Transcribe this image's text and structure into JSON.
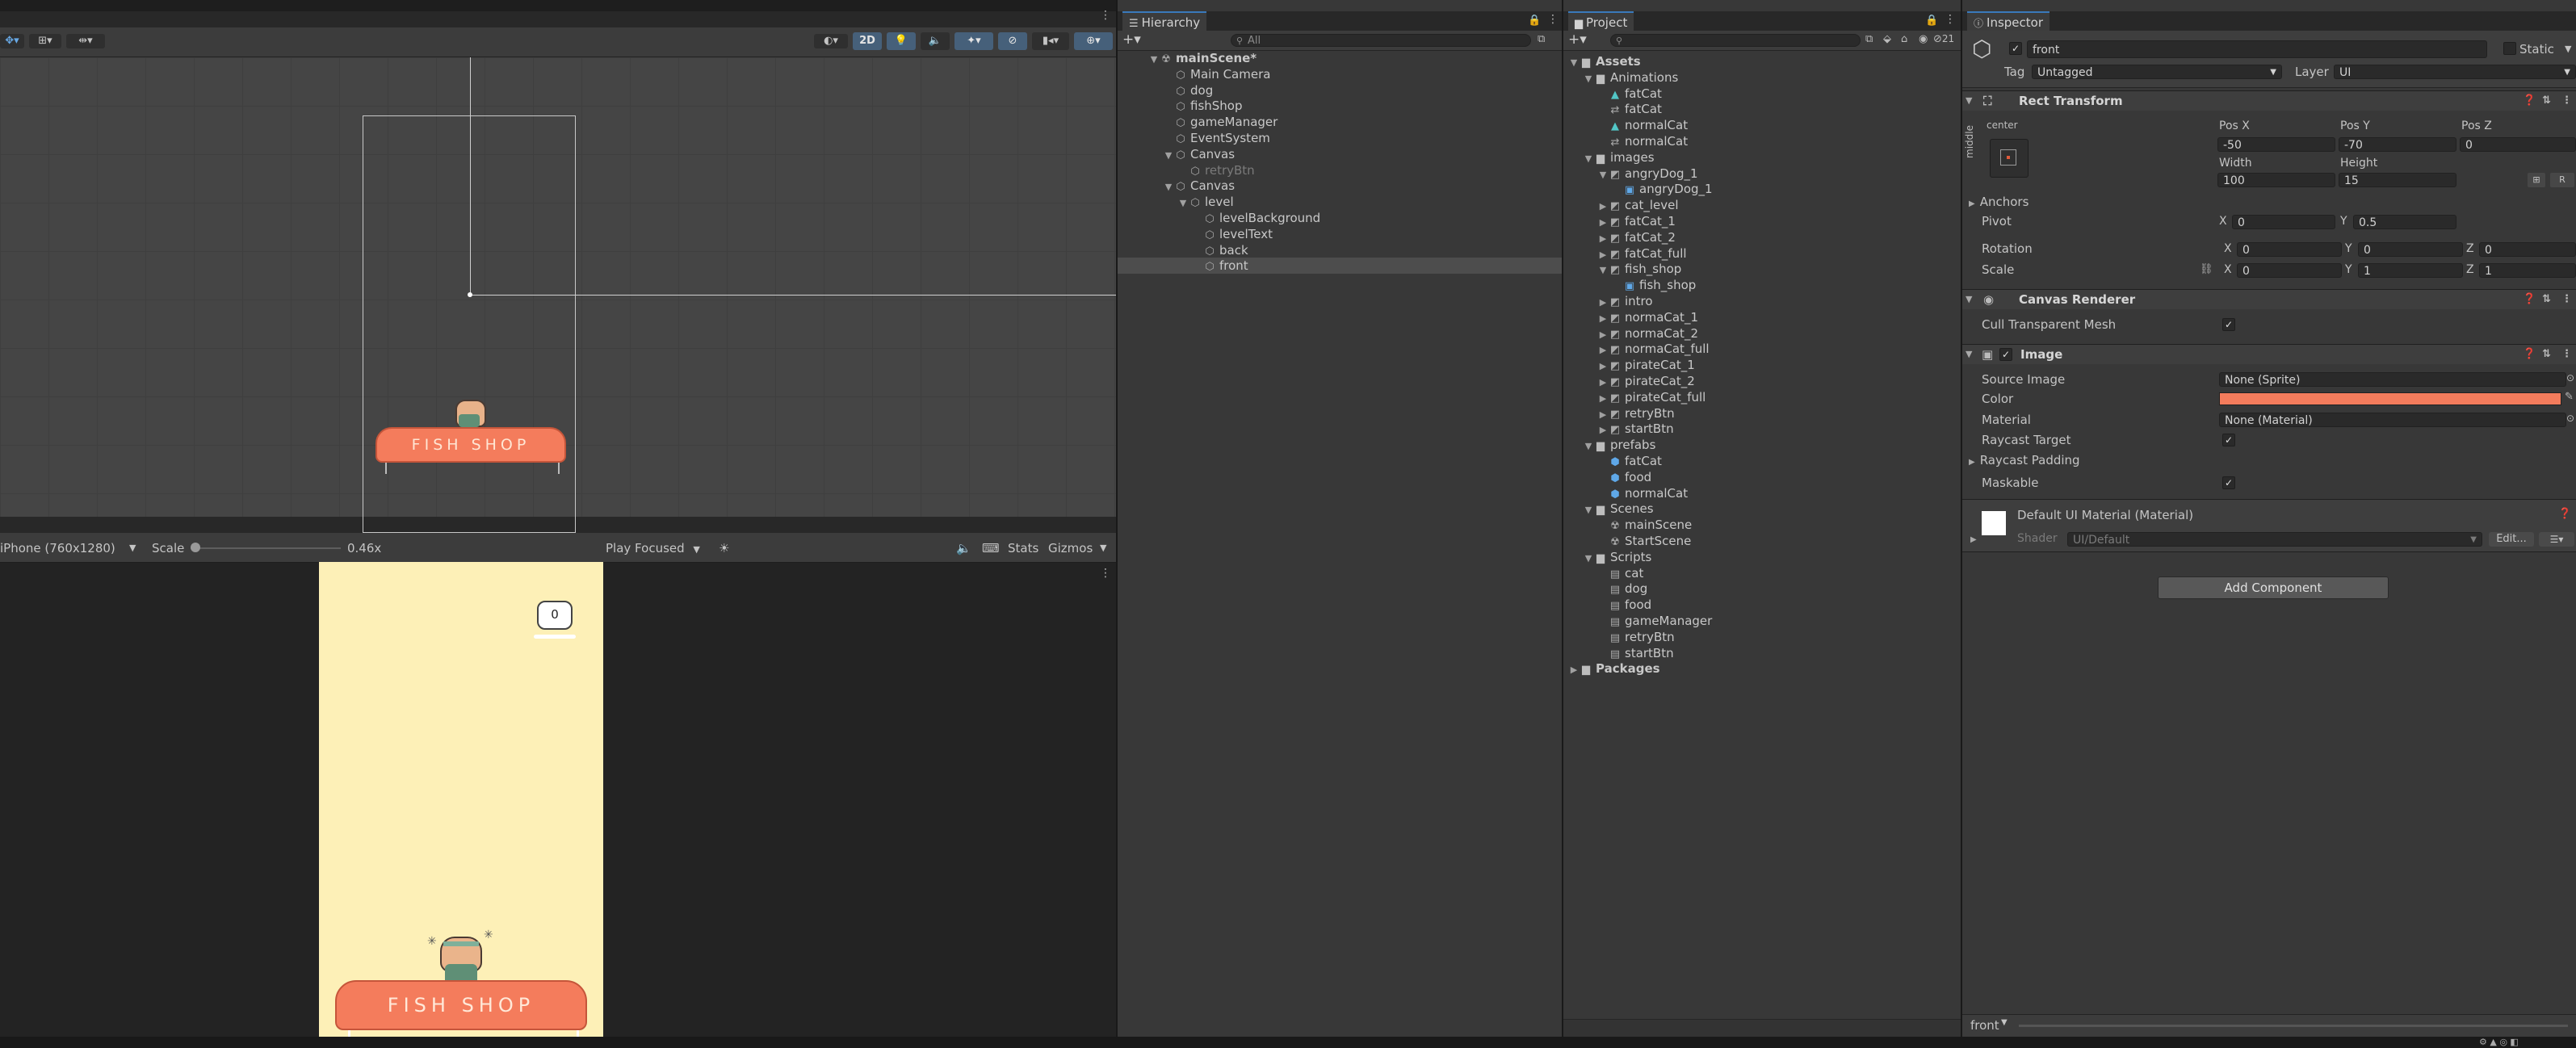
{
  "scene": {
    "tools_left": [
      "move-gizmo",
      "rect-tool",
      "snap-tool"
    ],
    "btn_2d": "2D",
    "gizmo_dropdowns": [
      "lighting",
      "audio",
      "effects",
      "hidden",
      "camera",
      "gizmos"
    ]
  },
  "game": {
    "resolution": "iPhone (760x1280)",
    "scale_label": "Scale",
    "scale_value": "0.46x",
    "play_mode": "Play Focused",
    "stats": "Stats",
    "gizmos": "Gizmos",
    "score": "0",
    "shop_sign": "FISH  SHOP",
    "colors": {
      "background": "#fdf0b7",
      "awning": "#f47c5c"
    }
  },
  "hierarchy": {
    "tab": "Hierarchy",
    "search_placeholder": "All",
    "items": [
      {
        "label": "mainScene*",
        "depth": 0,
        "icon": "unity-scene-icon",
        "expanded": true,
        "bold": true
      },
      {
        "label": "Main Camera",
        "depth": 1,
        "icon": "gameobject-icon"
      },
      {
        "label": "dog",
        "depth": 1,
        "icon": "gameobject-icon"
      },
      {
        "label": "fishShop",
        "depth": 1,
        "icon": "gameobject-icon"
      },
      {
        "label": "gameManager",
        "depth": 1,
        "icon": "gameobject-icon"
      },
      {
        "label": "EventSystem",
        "depth": 1,
        "icon": "gameobject-icon"
      },
      {
        "label": "Canvas",
        "depth": 1,
        "icon": "gameobject-icon",
        "expanded": true
      },
      {
        "label": "retryBtn",
        "depth": 2,
        "icon": "gameobject-icon",
        "disabled": true
      },
      {
        "label": "Canvas",
        "depth": 1,
        "icon": "gameobject-icon",
        "expanded": true
      },
      {
        "label": "level",
        "depth": 2,
        "icon": "gameobject-icon",
        "expanded": true
      },
      {
        "label": "levelBackground",
        "depth": 3,
        "icon": "gameobject-icon"
      },
      {
        "label": "levelText",
        "depth": 3,
        "icon": "gameobject-icon"
      },
      {
        "label": "back",
        "depth": 3,
        "icon": "gameobject-icon"
      },
      {
        "label": "front",
        "depth": 3,
        "icon": "gameobject-icon",
        "selected": true
      }
    ]
  },
  "project": {
    "tab": "Project",
    "badge": "21",
    "items": [
      {
        "label": "Assets",
        "depth": 0,
        "icon": "folder-icon",
        "expanded": true,
        "bold": true
      },
      {
        "label": "Animations",
        "depth": 1,
        "icon": "folder-icon",
        "expanded": true
      },
      {
        "label": "fatCat",
        "depth": 2,
        "icon": "animation-clip-icon"
      },
      {
        "label": "fatCat",
        "depth": 2,
        "icon": "animator-controller-icon"
      },
      {
        "label": "normalCat",
        "depth": 2,
        "icon": "animation-clip-icon"
      },
      {
        "label": "normalCat",
        "depth": 2,
        "icon": "animator-controller-icon"
      },
      {
        "label": "images",
        "depth": 1,
        "icon": "folder-icon",
        "expanded": true
      },
      {
        "label": "angryDog_1",
        "depth": 2,
        "icon": "texture-icon",
        "expanded": true
      },
      {
        "label": "angryDog_1",
        "depth": 3,
        "icon": "sprite-icon"
      },
      {
        "label": "cat_level",
        "depth": 2,
        "icon": "texture-icon",
        "collapsed": true
      },
      {
        "label": "fatCat_1",
        "depth": 2,
        "icon": "texture-icon",
        "collapsed": true
      },
      {
        "label": "fatCat_2",
        "depth": 2,
        "icon": "texture-icon",
        "collapsed": true
      },
      {
        "label": "fatCat_full",
        "depth": 2,
        "icon": "texture-icon",
        "collapsed": true
      },
      {
        "label": "fish_shop",
        "depth": 2,
        "icon": "texture-icon",
        "expanded": true
      },
      {
        "label": "fish_shop",
        "depth": 3,
        "icon": "sprite-icon"
      },
      {
        "label": "intro",
        "depth": 2,
        "icon": "texture-icon",
        "collapsed": true
      },
      {
        "label": "normaCat_1",
        "depth": 2,
        "icon": "texture-icon",
        "collapsed": true
      },
      {
        "label": "normaCat_2",
        "depth": 2,
        "icon": "texture-icon",
        "collapsed": true
      },
      {
        "label": "normaCat_full",
        "depth": 2,
        "icon": "texture-icon",
        "collapsed": true
      },
      {
        "label": "pirateCat_1",
        "depth": 2,
        "icon": "texture-icon",
        "collapsed": true
      },
      {
        "label": "pirateCat_2",
        "depth": 2,
        "icon": "texture-icon",
        "collapsed": true
      },
      {
        "label": "pirateCat_full",
        "depth": 2,
        "icon": "texture-icon",
        "collapsed": true
      },
      {
        "label": "retryBtn",
        "depth": 2,
        "icon": "texture-icon",
        "collapsed": true
      },
      {
        "label": "startBtn",
        "depth": 2,
        "icon": "texture-icon",
        "collapsed": true
      },
      {
        "label": "prefabs",
        "depth": 1,
        "icon": "folder-icon",
        "expanded": true
      },
      {
        "label": "fatCat",
        "depth": 2,
        "icon": "prefab-icon"
      },
      {
        "label": "food",
        "depth": 2,
        "icon": "prefab-icon"
      },
      {
        "label": "normalCat",
        "depth": 2,
        "icon": "prefab-icon"
      },
      {
        "label": "Scenes",
        "depth": 1,
        "icon": "folder-icon",
        "expanded": true
      },
      {
        "label": "mainScene",
        "depth": 2,
        "icon": "unity-scene-icon"
      },
      {
        "label": "StartScene",
        "depth": 2,
        "icon": "unity-scene-icon"
      },
      {
        "label": "Scripts",
        "depth": 1,
        "icon": "folder-icon",
        "expanded": true
      },
      {
        "label": "cat",
        "depth": 2,
        "icon": "script-icon"
      },
      {
        "label": "dog",
        "depth": 2,
        "icon": "script-icon"
      },
      {
        "label": "food",
        "depth": 2,
        "icon": "script-icon"
      },
      {
        "label": "gameManager",
        "depth": 2,
        "icon": "script-icon"
      },
      {
        "label": "retryBtn",
        "depth": 2,
        "icon": "script-icon"
      },
      {
        "label": "startBtn",
        "depth": 2,
        "icon": "script-icon"
      },
      {
        "label": "Packages",
        "depth": 0,
        "icon": "folder-icon",
        "collapsed": true,
        "bold": true
      }
    ]
  },
  "inspector": {
    "tab": "Inspector",
    "object_name": "front",
    "static_label": "Static",
    "tag_label": "Tag",
    "tag_value": "Untagged",
    "layer_label": "Layer",
    "layer_value": "UI",
    "rect_transform": {
      "title": "Rect Transform",
      "anchor_h": "center",
      "anchor_v": "middle",
      "pos_x_label": "Pos X",
      "pos_x": "-50",
      "pos_y_label": "Pos Y",
      "pos_y": "-70",
      "pos_z_label": "Pos Z",
      "pos_z": "0",
      "width_label": "Width",
      "width": "100",
      "height_label": "Height",
      "height": "15",
      "anchors_label": "Anchors",
      "pivot_label": "Pivot",
      "pivot_x": "0",
      "pivot_y": "0.5",
      "rotation_label": "Rotation",
      "rot_x": "0",
      "rot_y": "0",
      "rot_z": "0",
      "scale_label": "Scale",
      "scale_x": "0",
      "scale_y": "1",
      "scale_z": "1",
      "x": "X",
      "y": "Y",
      "z": "Z",
      "r_btn": "R"
    },
    "canvas_renderer": {
      "title": "Canvas Renderer",
      "cull_label": "Cull Transparent Mesh"
    },
    "image": {
      "title": "Image",
      "source_label": "Source Image",
      "source_value": "None (Sprite)",
      "color_label": "Color",
      "color_value": "#f47c5c",
      "material_label": "Material",
      "material_value": "None (Material)",
      "raycast_label": "Raycast Target",
      "raycast_padding_label": "Raycast Padding",
      "maskable_label": "Maskable"
    },
    "material": {
      "title": "Default UI Material (Material)",
      "shader_label": "Shader",
      "shader_value": "UI/Default",
      "edit_label": "Edit..."
    },
    "add_component": "Add Component",
    "footer_label": "front"
  }
}
